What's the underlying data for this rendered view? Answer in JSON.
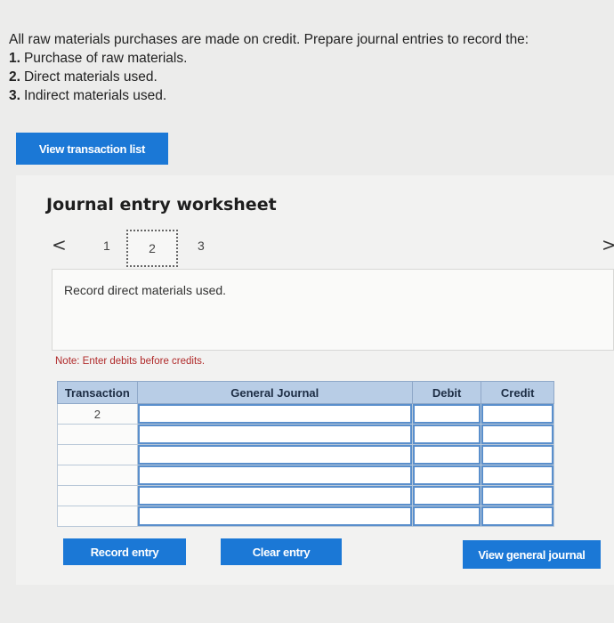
{
  "intro": {
    "line0": "All raw materials purchases are made on credit. Prepare journal entries to record the:",
    "items": [
      {
        "num": "1.",
        "text": "Purchase of raw materials."
      },
      {
        "num": "2.",
        "text": "Direct materials used."
      },
      {
        "num": "3.",
        "text": "Indirect materials used."
      }
    ]
  },
  "buttons": {
    "view_transaction_list": "View transaction list",
    "record_entry": "Record entry",
    "clear_entry": "Clear entry",
    "view_general_journal": "View general journal"
  },
  "worksheet": {
    "title": "Journal entry worksheet",
    "nav_prev": "<",
    "nav_next": ">",
    "steps": [
      "1",
      "2",
      "3"
    ],
    "active_step": "2",
    "description": "Record direct materials used.",
    "note": "Note: Enter debits before credits."
  },
  "journal": {
    "headers": {
      "transaction": "Transaction",
      "general_journal": "General Journal",
      "debit": "Debit",
      "credit": "Credit"
    },
    "rows": [
      {
        "transaction": "2",
        "account": "",
        "debit": "",
        "credit": ""
      },
      {
        "transaction": "",
        "account": "",
        "debit": "",
        "credit": ""
      },
      {
        "transaction": "",
        "account": "",
        "debit": "",
        "credit": ""
      },
      {
        "transaction": "",
        "account": "",
        "debit": "",
        "credit": ""
      },
      {
        "transaction": "",
        "account": "",
        "debit": "",
        "credit": ""
      },
      {
        "transaction": "",
        "account": "",
        "debit": "",
        "credit": ""
      }
    ]
  },
  "colors": {
    "accent": "#1b78d6",
    "header": "#b8cde6",
    "note": "#b02a2a"
  }
}
